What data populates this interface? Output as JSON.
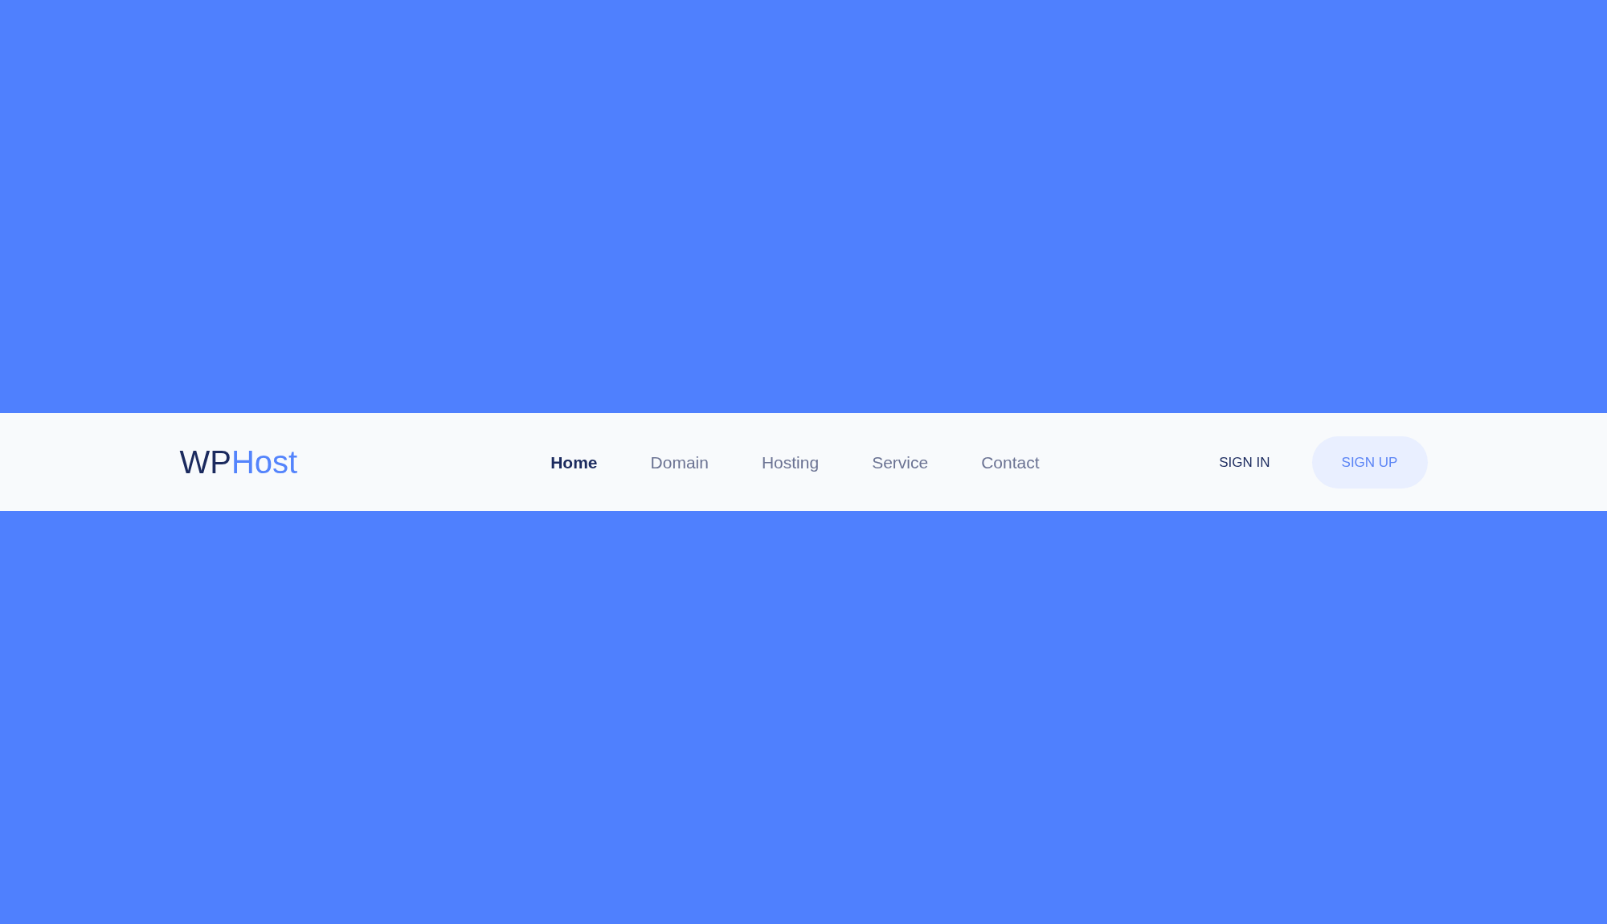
{
  "logo": {
    "name": "WP",
    "accent": "Host"
  },
  "nav": [
    {
      "label": "Home",
      "selected": true
    },
    {
      "label": "Domain",
      "selected": false
    },
    {
      "label": "Hosting",
      "selected": false
    },
    {
      "label": "Service",
      "selected": false
    },
    {
      "label": "Contact",
      "selected": false
    }
  ],
  "actions": [
    {
      "label": "SIGN IN",
      "kind": "text"
    },
    {
      "label": "SIGN UP",
      "kind": "pill"
    }
  ]
}
